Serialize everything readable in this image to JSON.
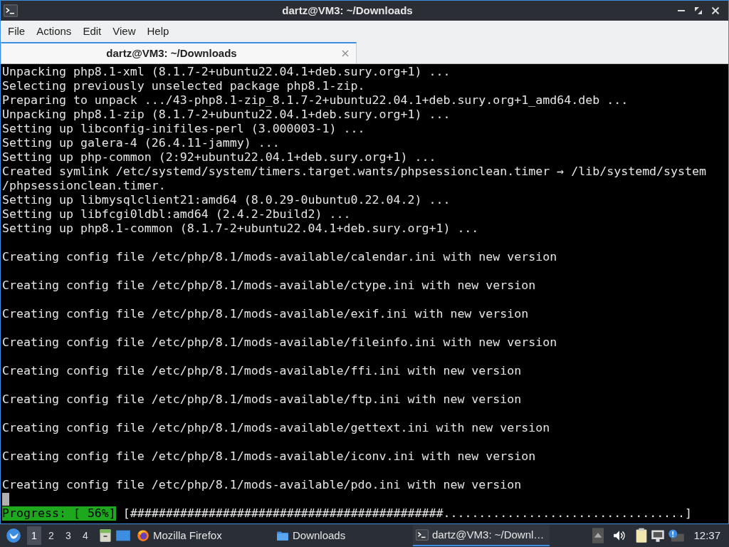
{
  "window": {
    "title": "dartz@VM3: ~/Downloads"
  },
  "menu": [
    "File",
    "Actions",
    "Edit",
    "View",
    "Help"
  ],
  "tabs": [
    {
      "label": "dartz@VM3: ~/Downloads",
      "selected": true
    }
  ],
  "terminal": {
    "blocks": [
      [
        "Unpacking php8.1-xml (8.1.7-2+ubuntu22.04.1+deb.sury.org+1) ...",
        "Selecting previously unselected package php8.1-zip.",
        "Preparing to unpack .../43-php8.1-zip_8.1.7-2+ubuntu22.04.1+deb.sury.org+1_amd64.deb ...",
        "Unpacking php8.1-zip (8.1.7-2+ubuntu22.04.1+deb.sury.org+1) ...",
        "Setting up libconfig-inifiles-perl (3.000003-1) ...",
        "Setting up galera-4 (26.4.11-jammy) ...",
        "Setting up php-common (2:92+ubuntu22.04.1+deb.sury.org+1) ...",
        "Created symlink /etc/systemd/system/timers.target.wants/phpsessionclean.timer → /lib/systemd/system",
        "/phpsessionclean.timer.",
        "Setting up libmysqlclient21:amd64 (8.0.29-0ubuntu0.22.04.2) ...",
        "Setting up libfcgi0ldbl:amd64 (2.4.2-2build2) ...",
        "Setting up php8.1-common (8.1.7-2+ubuntu22.04.1+deb.sury.org+1) ..."
      ],
      [
        "Creating config file /etc/php/8.1/mods-available/calendar.ini with new version"
      ],
      [
        "Creating config file /etc/php/8.1/mods-available/ctype.ini with new version"
      ],
      [
        "Creating config file /etc/php/8.1/mods-available/exif.ini with new version"
      ],
      [
        "Creating config file /etc/php/8.1/mods-available/fileinfo.ini with new version"
      ],
      [
        "Creating config file /etc/php/8.1/mods-available/ffi.ini with new version"
      ],
      [
        "Creating config file /etc/php/8.1/mods-available/ftp.ini with new version"
      ],
      [
        "Creating config file /etc/php/8.1/mods-available/gettext.ini with new version"
      ],
      [
        "Creating config file /etc/php/8.1/mods-available/iconv.ini with new version"
      ],
      [
        "Creating config file /etc/php/8.1/mods-available/pdo.ini with new version"
      ]
    ],
    "progress_label": "Progress: [ 56%]",
    "progress_bar": "[############################################..................................]"
  },
  "taskbar": {
    "workspaces": [
      {
        "label": "1",
        "selected": true
      },
      {
        "label": "2",
        "selected": false
      },
      {
        "label": "3",
        "selected": false
      },
      {
        "label": "4",
        "selected": false
      }
    ],
    "tasks": [
      {
        "label": "Mozilla Firefox",
        "kind": "browser",
        "selected": false
      },
      {
        "label": "Downloads",
        "kind": "folder",
        "selected": false
      },
      {
        "label": "dartz@VM3: ~/Downl…",
        "kind": "terminal",
        "selected": true
      }
    ],
    "clock": "12:37"
  }
}
